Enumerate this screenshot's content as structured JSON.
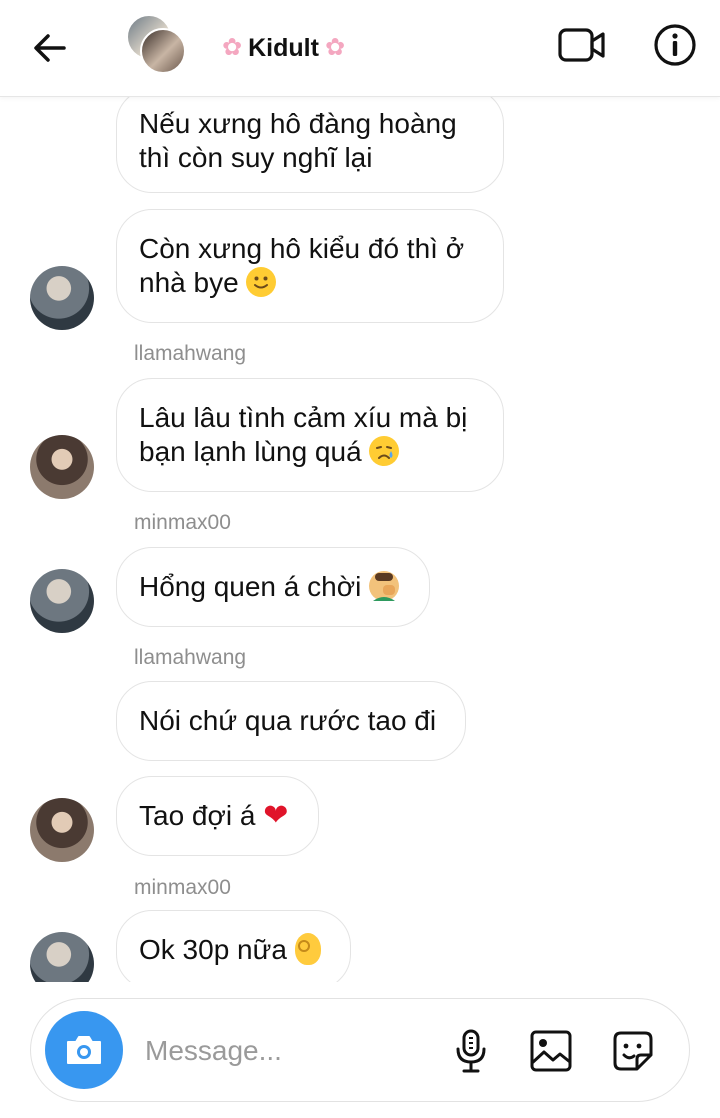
{
  "header": {
    "title": "Kidult",
    "title_decoration": "cherry-blossom",
    "back_icon": "arrow-left-icon",
    "video_icon": "video-camera-icon",
    "info_icon": "info-icon"
  },
  "messages": [
    {
      "sender": "",
      "text": "Nếu xưng hô đàng hoàng thì còn suy nghĩ lại",
      "emoji": ""
    },
    {
      "sender": "",
      "text": "Còn xưng hô kiểu đó thì ở nhà bye",
      "emoji": "slightly-smiling-face"
    },
    {
      "sender": "llamahwang",
      "text": "Lâu lâu tình cảm xíu mà bị bạn lạnh lùng quá",
      "emoji": "crying-face"
    },
    {
      "sender": "minmax00",
      "text": "Hổng quen á chời",
      "emoji": "facepalm"
    },
    {
      "sender": "llamahwang",
      "text": "Nói chứ qua rước tao đi",
      "emoji": ""
    },
    {
      "sender": "",
      "text": "Tao đợi á",
      "emoji": "red-heart"
    },
    {
      "sender": "minmax00",
      "text": "Ok 30p nữa",
      "emoji": "ok-hand"
    }
  ],
  "composer": {
    "placeholder": "Message...",
    "camera_icon": "camera-icon",
    "mic_icon": "microphone-icon",
    "gallery_icon": "image-icon",
    "sticker_icon": "sticker-icon"
  },
  "colors": {
    "accent": "#3897f0",
    "bubble_border": "#e4e4e4",
    "sender_text": "#8e8e8e"
  }
}
